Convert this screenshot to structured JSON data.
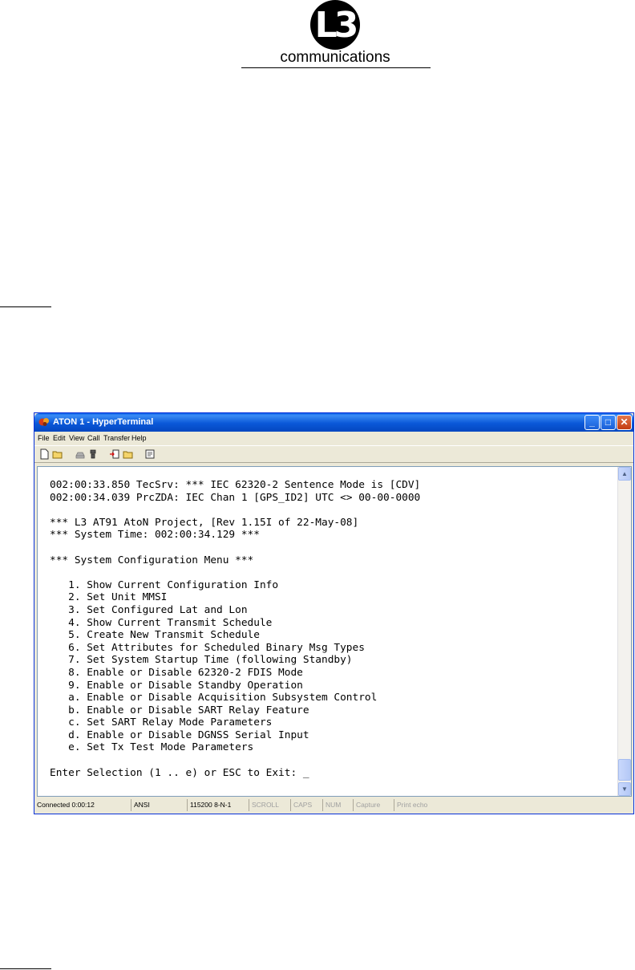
{
  "document": {
    "logo": {
      "mark": "L3",
      "text": "communications"
    }
  },
  "window": {
    "title": "ATON 1 - HyperTerminal",
    "menu": [
      "File",
      "Edit",
      "View",
      "Call",
      "Transfer",
      "Help"
    ],
    "toolbar_icons": [
      "new-document-icon",
      "open-folder-icon",
      "call-phone-icon",
      "disconnect-icon",
      "send-icon",
      "receive-icon",
      "properties-icon"
    ],
    "terminal_lines": [
      "002:00:33.850 TecSrv: *** IEC 62320-2 Sentence Mode is [CDV]",
      "002:00:34.039 PrcZDA: IEC Chan 1 [GPS_ID2] UTC <> 00-00-0000",
      "",
      "*** L3 AT91 AtoN Project, [Rev 1.15I of 22-May-08]",
      "*** System Time: 002:00:34.129 ***",
      "",
      "*** System Configuration Menu ***",
      "",
      "   1. Show Current Configuration Info",
      "   2. Set Unit MMSI",
      "   3. Set Configured Lat and Lon",
      "   4. Show Current Transmit Schedule",
      "   5. Create New Transmit Schedule",
      "   6. Set Attributes for Scheduled Binary Msg Types",
      "   7. Set System Startup Time (following Standby)",
      "   8. Enable or Disable 62320-2 FDIS Mode",
      "   9. Enable or Disable Standby Operation",
      "   a. Enable or Disable Acquisition Subsystem Control",
      "   b. Enable or Disable SART Relay Feature",
      "   c. Set SART Relay Mode Parameters",
      "   d. Enable or Disable DGNSS Serial Input",
      "   e. Set Tx Test Mode Parameters",
      "",
      "Enter Selection (1 .. e) or ESC to Exit: _"
    ],
    "status": {
      "connected": "Connected 0:00:12",
      "emulation": "ANSI",
      "settings": "115200 8-N-1",
      "scroll": "SCROLL",
      "caps": "CAPS",
      "num": "NUM",
      "capture": "Capture",
      "print_echo": "Print echo"
    }
  }
}
